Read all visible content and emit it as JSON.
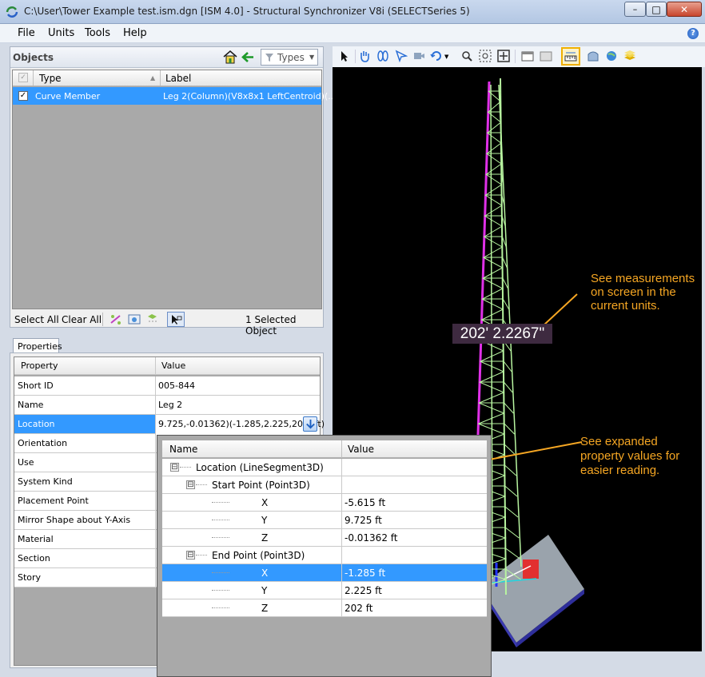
{
  "window": {
    "title": "C:\\User\\Tower Example test.ism.dgn [ISM 4.0] - Structural Synchronizer V8i (SELECTSeries 5)",
    "minimize_glyph": "–",
    "maximize_glyph": "□",
    "close_glyph": "✕"
  },
  "menu": {
    "file": "File",
    "units": "Units",
    "tools": "Tools",
    "help": "Help"
  },
  "help_glyph": "?",
  "objects": {
    "title": "Objects",
    "types_label": "Types",
    "columns": {
      "type": "Type",
      "label": "Label"
    },
    "rows": [
      {
        "type": "Curve Member",
        "label": "Leg 2(Column)(V8x8x1 LeftCentroid)(...",
        "checked": true
      }
    ],
    "select_all": "Select All",
    "clear_all": "Clear All",
    "status": "1 Selected Object"
  },
  "properties": {
    "tab_label": "Properties",
    "columns": {
      "property": "Property",
      "value": "Value"
    },
    "rows": [
      {
        "name": "Short ID",
        "value": "005-844"
      },
      {
        "name": "Name",
        "value": "Leg 2"
      },
      {
        "name": "Location",
        "value": "9.725,-0.01362)(-1.285,2.225,202) ft)"
      },
      {
        "name": "Orientation",
        "value": ""
      },
      {
        "name": "Use",
        "value": ""
      },
      {
        "name": "System Kind",
        "value": ""
      },
      {
        "name": "Placement Point",
        "value": ""
      },
      {
        "name": "Mirror Shape about Y-Axis",
        "value": ""
      },
      {
        "name": "Material",
        "value": ""
      },
      {
        "name": "Section",
        "value": ""
      },
      {
        "name": "Story",
        "value": ""
      }
    ]
  },
  "viewport": {
    "measurement": "202' 2.2267\"",
    "callout_measure": "See measurements on screen in the current units.",
    "callout_props": "See expanded property values for easier reading."
  },
  "popup": {
    "columns": {
      "name": "Name",
      "value": "Value"
    },
    "rows": [
      {
        "name": "Location (LineSegment3D)",
        "value": "",
        "level": 0,
        "expander": "⊟"
      },
      {
        "name": "Start Point (Point3D)",
        "value": "",
        "level": 1,
        "expander": "⊟"
      },
      {
        "name": "X",
        "value": "-5.615 ft",
        "level": 2
      },
      {
        "name": "Y",
        "value": "9.725 ft",
        "level": 2
      },
      {
        "name": "Z",
        "value": "-0.01362 ft",
        "level": 2
      },
      {
        "name": "End Point (Point3D)",
        "value": "",
        "level": 1,
        "expander": "⊟"
      },
      {
        "name": "X",
        "value": "-1.285 ft",
        "level": 2,
        "selected": true
      },
      {
        "name": "Y",
        "value": "2.225 ft",
        "level": 2
      },
      {
        "name": "Z",
        "value": "202 ft",
        "level": 2
      }
    ]
  },
  "colors": {
    "selection": "#3399ff",
    "callout": "#f5a623",
    "tower_green": "#b8f5a0",
    "tower_magenta": "#e030e8"
  }
}
